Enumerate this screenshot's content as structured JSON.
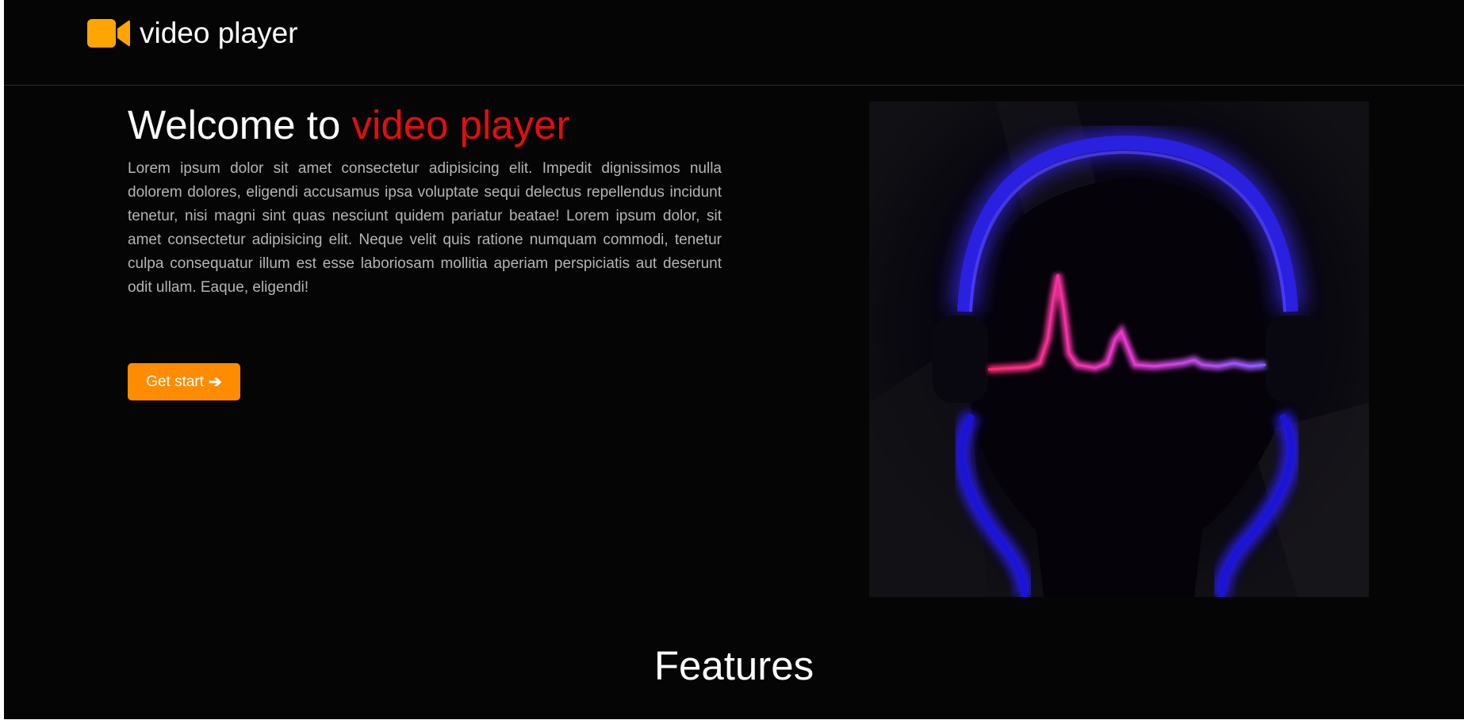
{
  "header": {
    "brand_name": "video player",
    "brand_icon": "video-camera-icon"
  },
  "hero": {
    "title_prefix": "Welcome to ",
    "title_accent": "video player",
    "description": "Lorem ipsum dolor sit amet consectetur adipisicing elit. Impedit dignissimos nulla dolorem dolores, eligendi accusamus ipsa voluptate sequi delectus repellendus incidunt tenetur, nisi magni sint quas nesciunt quidem pariatur beatae! Lorem ipsum dolor, sit amet consectetur adipisicing elit. Neque velit quis ratione numquam commodi, tenetur culpa consequatur illum est esse laboriosam mollitia aperiam perspiciatis aut deserunt odit ullam. Eaque, eligendi!",
    "cta_label": "Get start",
    "cta_icon": "arrow-right-icon",
    "image_subject": "headphones-soundwave-illustration"
  },
  "features": {
    "title": "Features"
  },
  "colors": {
    "background": "#050505",
    "accent_red": "#e50d0d",
    "brand_orange": "#ff8c00",
    "icon_orange": "#ffa500"
  }
}
